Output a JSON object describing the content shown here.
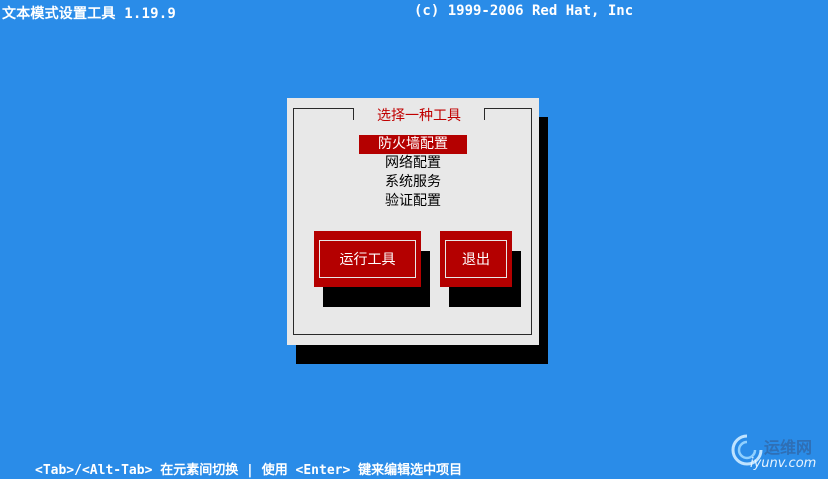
{
  "header": {
    "title": "文本模式设置工具 1.19.9",
    "copyright": "(c) 1999-2006 Red Hat, Inc"
  },
  "dialog": {
    "title": "选择一种工具",
    "items": [
      {
        "label": "防火墙配置",
        "selected": true
      },
      {
        "label": "网络配置",
        "selected": false
      },
      {
        "label": "系统服务",
        "selected": false
      },
      {
        "label": "验证配置",
        "selected": false
      }
    ],
    "buttons": {
      "run_label": "运行工具",
      "quit_label": "退出"
    }
  },
  "footer": {
    "hint": "<Tab>/<Alt-Tab> 在元素间切换  |    使用 <Enter> 键来编辑选中项目"
  },
  "watermark": {
    "cn": "运维网",
    "en": "iyunv.com"
  },
  "colors": {
    "background": "#2a8ce8",
    "dialog": "#e8e8e8",
    "accent": "#b40000"
  }
}
